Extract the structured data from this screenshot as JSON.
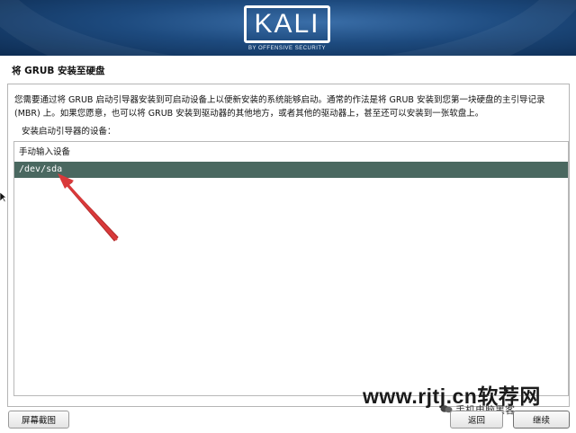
{
  "header": {
    "logo_text": "KALI",
    "logo_subtitle": "BY OFFENSIVE SECURITY"
  },
  "page": {
    "title": "将 GRUB 安装至硬盘",
    "description_line1": "您需要通过将 GRUB 启动引导器安装到可启动设备上以便新安装的系统能够启动。通常的作法是将 GRUB 安装到您第一块硬盘的主引导记录",
    "description_line2": "(MBR) 上。如果您愿意，也可以将 GRUB 安装到驱动器的其他地方，或者其他的驱动器上，甚至还可以安装到一张软盘上。",
    "prompt": "安装启动引导器的设备："
  },
  "device_list": {
    "items": [
      {
        "label": "手动输入设备",
        "selected": false
      },
      {
        "label": "/dev/sda",
        "selected": true
      }
    ],
    "selected_color": "#4a6860"
  },
  "annotation": {
    "arrow_color": "#d9393a"
  },
  "watermark": {
    "text": "www.rjtj.cn软荐网",
    "subtext": "手机电脑黑客"
  },
  "buttons": {
    "screenshot": "屏幕截图",
    "back": "返回",
    "continue": "继续"
  }
}
